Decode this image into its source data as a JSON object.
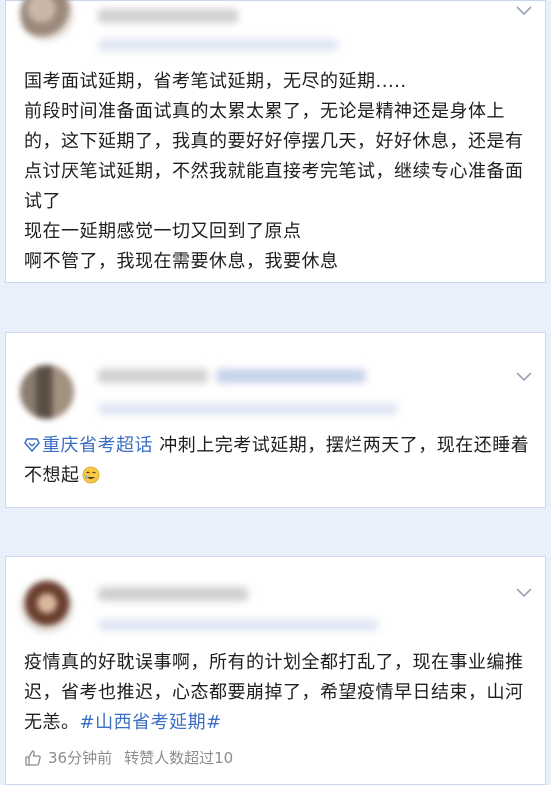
{
  "posts": [
    {
      "lines": [
        "国考面试延期，省考笔试延期，无尽的延期.....",
        "前段时间准备面试真的太累太累了，无论是精神还是身体上的，这下延期了，我真的要好好停摆几天，好好休息，还是有点讨厌笔试延期，不然我就能直接考完笔试，继续专心准备面试了",
        "现在一延期感觉一切又回到了原点",
        "啊不管了，我现在需要休息，我要休息"
      ]
    },
    {
      "topic": "重庆省考超话",
      "body": " 冲刺上完考试延期，摆烂两天了，现在还睡着不想起",
      "emoji": "smiling-with-tear-icon"
    },
    {
      "body": "疫情真的好耽误事啊，所有的计划全都打乱了，现在事业编推迟，省考也推迟，心态都要崩掉了，希望疫情早日结束，山河无恙。",
      "hashtag": "#山西省考延期#",
      "footer": {
        "time": "36分钟前",
        "stat": "转赞人数超过10"
      }
    }
  ],
  "colors": {
    "accent": "#3b6fc4",
    "background": "#eaf0fb",
    "card": "#ffffff",
    "muted": "#8c8c8c"
  }
}
